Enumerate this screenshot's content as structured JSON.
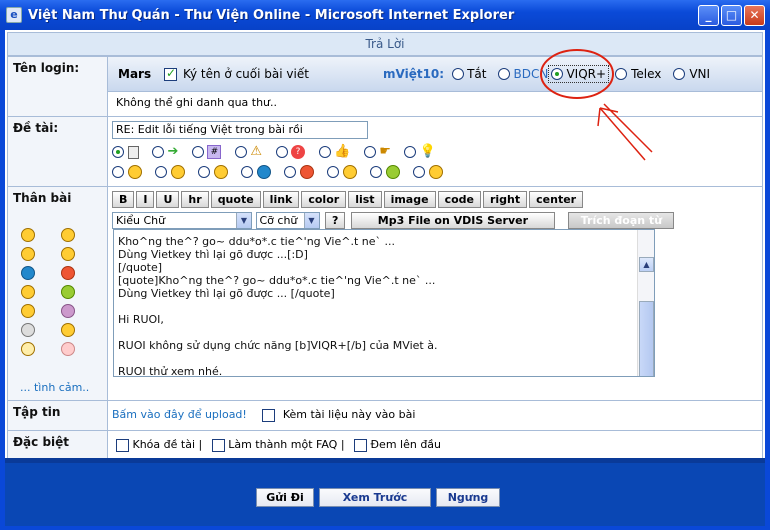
{
  "window": {
    "title": "Việt Nam Thư Quán - Thư Viện Online - Microsoft Internet Explorer",
    "icon": "ie-page-icon",
    "min": "_",
    "max": "□",
    "close": "✕"
  },
  "form_header": "Trả Lời",
  "login": {
    "label": "Tên login:",
    "username": "Mars",
    "sign_label": "Ký tên ở cuối bài viết",
    "sign_checked": true,
    "mviet_label": "mViệt10:",
    "modes": [
      "Tắt",
      "BDCN",
      "VIQR+",
      "Telex",
      "VNI"
    ],
    "selected_mode": "VIQR+",
    "note": "Không thể ghi danh qua thư.."
  },
  "topic": {
    "label": "Đề tài:",
    "value": "RE: Edit lỗi tiếng Việt trong bài rồi"
  },
  "body": {
    "label": "Thân bài",
    "toolbar": [
      "B",
      "I",
      "U",
      "hr",
      "quote",
      "link",
      "color",
      "list",
      "image",
      "code",
      "right",
      "center"
    ],
    "style_select": "Kiểu Chữ",
    "size_select": "Cỡ chữ",
    "help": "?",
    "mp3": "Mp3 File on VDIS Server",
    "quote_btn": "Trích đoạn từ",
    "more_emotes": "... tình cảm..",
    "text": "Kho^ng the^? go~ ddu*o*.c tie^'ng Vie^.t ne` ...\nDùng Vietkey thì lại gõ được ...[:D]\n[/quote]\n[quote]Kho^ng the^? go~ ddu*o*.c tie^'ng Vie^.t ne` ...\nDùng Vietkey thì lại gõ được ... [/quote]\n\nHi RUOI,\n\nRUOI không sử dụng chức năng [b]VIQR+[/b] của MViet à.\n\nRUOI thử xem nhé."
  },
  "attach": {
    "label": "Tập tin",
    "upload_link": "Bấm vào đây để upload!",
    "attach_label": "Kèm tài liệu này vào bài"
  },
  "special": {
    "label": "Đặc biệt",
    "options": [
      "Khóa đề tài |",
      "Làm thành một FAQ |",
      "Đem lên đầu"
    ]
  },
  "buttons": {
    "submit": "Gửi Đi",
    "preview": "Xem Trước",
    "stop": "Ngưng"
  }
}
